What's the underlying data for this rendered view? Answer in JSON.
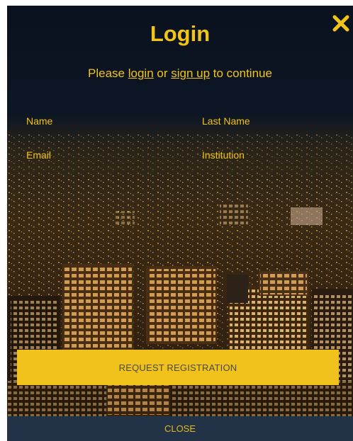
{
  "modal": {
    "title": "Login",
    "subtitle_prefix": "Please ",
    "login_link": "login",
    "subtitle_middle": " or ",
    "signup_link": "sign up",
    "subtitle_suffix": " to continue"
  },
  "form": {
    "name_placeholder": "Name",
    "last_name_placeholder": "Last Name",
    "email_placeholder": "Email",
    "institution_placeholder": "Institution"
  },
  "actions": {
    "request_label": "REQUEST REGISTRATION",
    "close_label": "CLOSE"
  },
  "icons": {
    "close": "close-x-icon"
  },
  "colors": {
    "accent": "#f0c419",
    "button": "#f1c21b",
    "close_bar": "#223347",
    "background": "#0b1220"
  }
}
